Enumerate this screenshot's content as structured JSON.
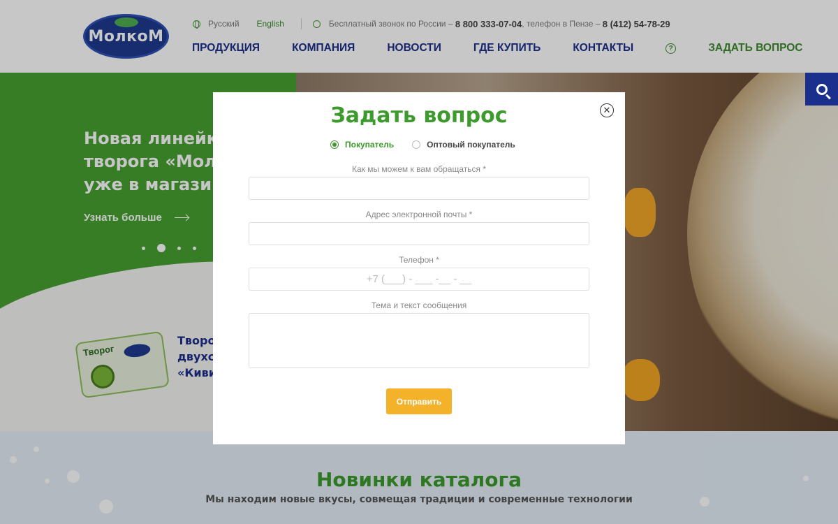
{
  "header": {
    "logo_text": "МолкоМ",
    "lang_ru": "Русский",
    "lang_en": "English",
    "free_call_text": "Бесплатный звонок по России –",
    "free_call_number": "8 800 333-07-04",
    "penza_text": ", телефон в Пензе –",
    "penza_number": "8 (412) 54-78-29"
  },
  "nav": {
    "items": [
      {
        "label": "ПРОДУКЦИЯ"
      },
      {
        "label": "КОМПАНИЯ"
      },
      {
        "label": "НОВОСТИ"
      },
      {
        "label": "ГДЕ КУПИТЬ"
      },
      {
        "label": "КОНТАКТЫ"
      }
    ],
    "ask_label": "ЗАДАТЬ ВОПРОС"
  },
  "hero": {
    "title_line1": "Новая линейка",
    "title_line2": "творога «Молк",
    "title_line3": "уже в магазин",
    "learn_more": "Узнать больше",
    "product_label": "Творог",
    "product_name_line1": "Творог",
    "product_name_line2": "двухсл",
    "product_name_line3": "«Киви»"
  },
  "catalog": {
    "title": "Новинки каталога",
    "subtitle": "Мы находим новые вкусы, совмещая традиции и современные технологии"
  },
  "modal": {
    "title": "Задать вопрос",
    "radio_buyer": "Покупатель",
    "radio_wholesale": "Оптовый покупатель",
    "name_label": "Как мы можем к вам обращаться *",
    "email_label": "Адрес электронной почты *",
    "phone_label": "Телефон *",
    "phone_placeholder": "+7 (___) - ___ -__ - __",
    "message_label": "Тема и текст сообщения",
    "submit_label": "Отправить"
  },
  "colors": {
    "brand_blue": "#1b2f8c",
    "brand_green": "#3d9a2d",
    "submit_orange": "#f4b22b"
  }
}
